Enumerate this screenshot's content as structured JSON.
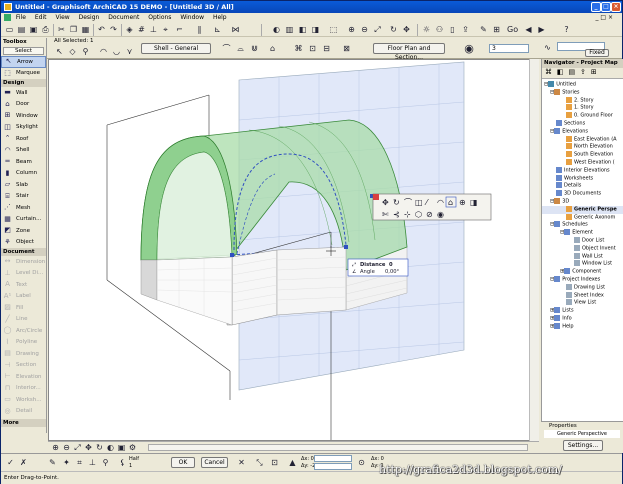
{
  "window": {
    "title": "Untitled - Graphisoft ArchiCAD 15 DEMO - [Untitled 3D / All]",
    "min": "_",
    "max": "□",
    "close": "×"
  },
  "menu": [
    "File",
    "Edit",
    "View",
    "Design",
    "Document",
    "Options",
    "Window",
    "Help"
  ],
  "toolbar": {
    "all_selected": "All Selected: 1",
    "shell_settings": "Shell - General",
    "floor_plan_section": "Floor Plan and Section...",
    "angle_value": "3",
    "go_label": "Go",
    "fixed_label": "Fixed"
  },
  "toolbox": {
    "title": "Toolbox",
    "select": "Select",
    "design_group": "Design",
    "document_group": "Document",
    "more": "More",
    "items": {
      "arrow": "Arrow",
      "marquee": "Marquee",
      "wall": "Wall",
      "door": "Door",
      "window": "Window",
      "skylight": "Skylight",
      "roof": "Roof",
      "shell": "Shell",
      "beam": "Beam",
      "column": "Column",
      "slab": "Slab",
      "stair": "Stair",
      "mesh": "Mesh",
      "curtain": "Curtain...",
      "zone": "Zone",
      "object": "Object",
      "dimension": "Dimension",
      "level_dim": "Level Di...",
      "text": "Text",
      "label": "Label",
      "fill": "Fill",
      "line": "Line",
      "arc_circle": "Arc/Circle",
      "polyline": "Polyline",
      "drawing": "Drawing",
      "section": "Section",
      "elevation": "Elevation",
      "interior": "Interior...",
      "worksheet": "Worksh...",
      "detail": "Detail"
    }
  },
  "navigator": {
    "title": "Navigator - Project Map",
    "tree": {
      "untitled": "Untitled",
      "stories": "Stories",
      "story2": "2. Story",
      "story1": "1. Story",
      "story0": "0. Ground Floor",
      "sections": "Sections",
      "elevations": "Elevations",
      "east": "East Elevation (A",
      "north": "North Elevation",
      "south": "South Elevation",
      "west": "West Elevation (",
      "interior_elev": "Interior Elevations",
      "worksheets": "Worksheets",
      "details": "Details",
      "docs3d": "3D Documents",
      "threed": "3D",
      "generic_persp": "Generic Perspe",
      "generic_axon": "Generic Axonom",
      "schedules": "Schedules",
      "element": "Element",
      "door_list": "Door List",
      "object_inv": "Object Invent",
      "wall_list": "Wall List",
      "window_list": "Window List",
      "component": "Component",
      "project_indexes": "Project Indexes",
      "drawing_list": "Drawing List",
      "sheet_index": "Sheet Index",
      "view_list": "View List",
      "lists": "Lists",
      "info": "Info",
      "help": "Help"
    }
  },
  "properties": {
    "header": "Properties",
    "view_name": "Generic Perspective",
    "settings": "Settings..."
  },
  "tracker": {
    "distance_label": "Distance",
    "distance_value": "0",
    "angle_label": "Angle",
    "angle_value": "0,00°"
  },
  "infobar": {
    "ok": "OK",
    "cancel": "Cancel",
    "dx": "Δx: 0",
    "dy": "Δy: -2",
    "ax": "Δx: 0",
    "ay": "Δy: 0",
    "half": "Half",
    "scale_label": "1"
  },
  "status": {
    "text": "Enter Drag-to-Point."
  },
  "watermark": "http://grafica2d3d.blogspot.com/",
  "colors": {
    "shell_green": "#8fd08f",
    "selection_blue": "#3050c0",
    "plane_blue": "#c8d6f4",
    "title_blue": "#0a5bd8"
  }
}
